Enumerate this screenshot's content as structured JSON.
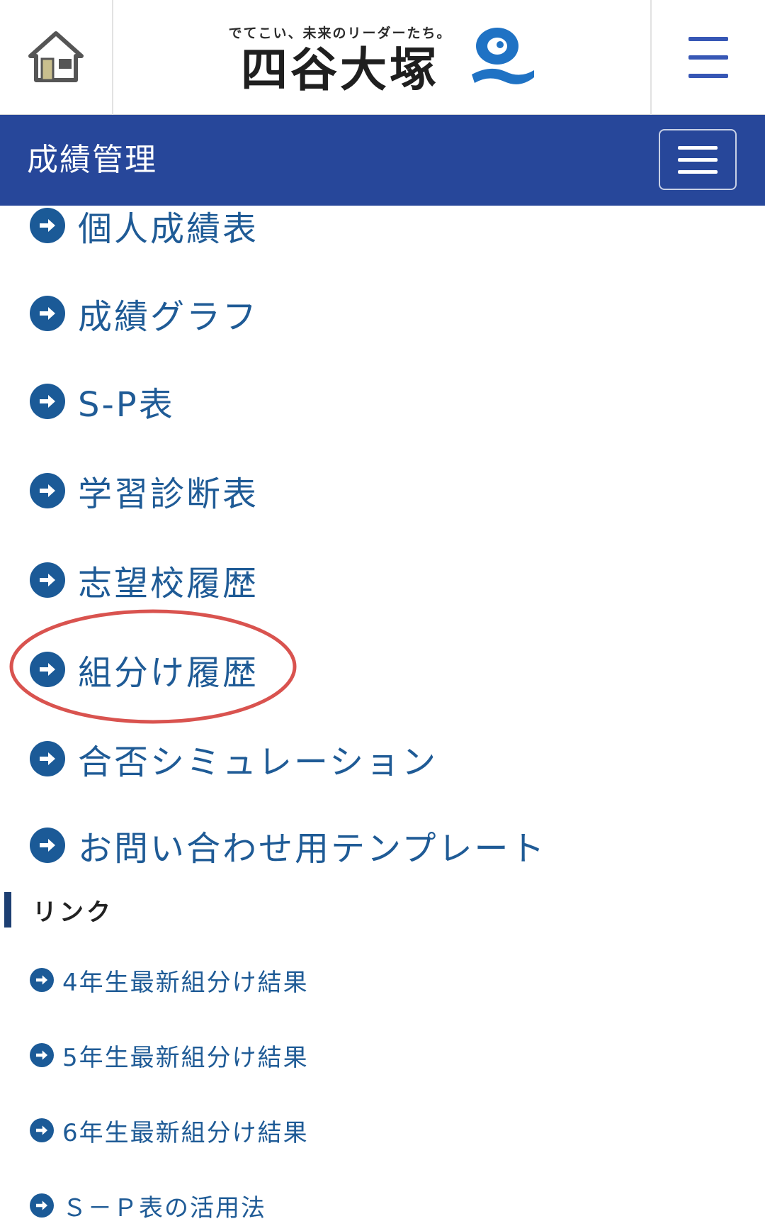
{
  "header": {
    "tagline": "でてこい、未来のリーダーたち。",
    "logo_name": "四谷大塚",
    "brand_color": "#1f72c4"
  },
  "section_bar": {
    "title": "成績管理",
    "color": "#27479a"
  },
  "menu": {
    "items": [
      {
        "label": "個人成績表"
      },
      {
        "label": "成績グラフ"
      },
      {
        "label": "S-P表"
      },
      {
        "label": "学習診断表"
      },
      {
        "label": "志望校履歴"
      },
      {
        "label": "組分け履歴",
        "highlighted": true
      },
      {
        "label": "合否シミュレーション"
      },
      {
        "label": "お問い合わせ用テンプレート"
      }
    ],
    "highlight_color": "#d9534f"
  },
  "links": {
    "title": "リンク",
    "items": [
      {
        "label": "4年生最新組分け結果"
      },
      {
        "label": "5年生最新組分け結果"
      },
      {
        "label": "6年生最新組分け結果"
      },
      {
        "label": "Ｓ－Ｐ表の活用法"
      }
    ]
  },
  "icons": {
    "home": "home-icon",
    "menu": "hamburger-menu-icon",
    "toggle": "navbar-toggle-icon",
    "arrow": "arrow-circle-right-icon",
    "logo": "mascot-logo-icon"
  },
  "colors": {
    "text_link": "#1f5b96",
    "arrow_icon": "#1b5a97",
    "link_bar": "#1d3f72"
  }
}
